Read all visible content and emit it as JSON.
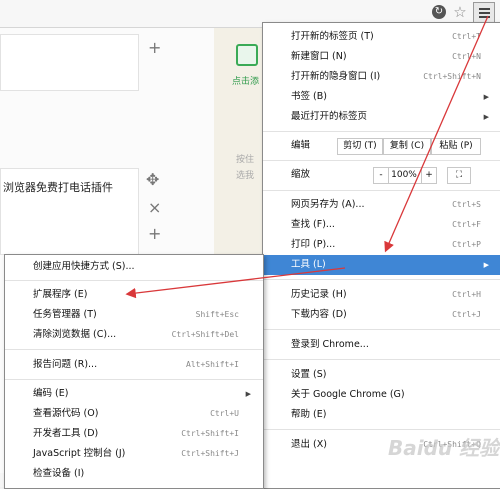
{
  "toolbar": {
    "refresh_glyph": "↻",
    "star_glyph": "☆"
  },
  "background": {
    "plus1": "+",
    "plus2": "+",
    "card2_text": "浏览器免费打电话插件",
    "move_glyph": "✥",
    "close_glyph": "×",
    "green_text": "点击添",
    "gray_text1": "按住",
    "gray_text2": "选我"
  },
  "main_menu": {
    "new_tab": {
      "label": "打开新的标签页 (T)",
      "shortcut": "Ctrl+T"
    },
    "new_window": {
      "label": "新建窗口 (N)",
      "shortcut": "Ctrl+N"
    },
    "incognito": {
      "label": "打开新的隐身窗口 (I)",
      "shortcut": "Ctrl+Shift+N"
    },
    "bookmarks": {
      "label": "书签 (B)"
    },
    "recent_tabs": {
      "label": "最近打开的标签页"
    },
    "edit": {
      "label": "编辑",
      "cut": "剪切 (T)",
      "copy": "复制 (C)",
      "paste": "粘贴 (P)"
    },
    "zoom": {
      "label": "缩放",
      "minus": "-",
      "value": "100%",
      "plus": "+",
      "fullscreen": "⛶"
    },
    "save_as": {
      "label": "网页另存为 (A)...",
      "shortcut": "Ctrl+S"
    },
    "find": {
      "label": "查找 (F)...",
      "shortcut": "Ctrl+F"
    },
    "print": {
      "label": "打印 (P)...",
      "shortcut": "Ctrl+P"
    },
    "tools": {
      "label": "工具 (L)"
    },
    "history": {
      "label": "历史记录 (H)",
      "shortcut": "Ctrl+H"
    },
    "downloads": {
      "label": "下载内容 (D)",
      "shortcut": "Ctrl+J"
    },
    "signin": {
      "label": "登录到 Chrome..."
    },
    "settings": {
      "label": "设置 (S)"
    },
    "about": {
      "label": "关于 Google Chrome (G)"
    },
    "help": {
      "label": "帮助 (E)"
    },
    "exit": {
      "label": "退出 (X)",
      "shortcut": "Ctrl+Shift+Q"
    }
  },
  "tools_menu": {
    "create_shortcut": {
      "label": "创建应用快捷方式 (S)..."
    },
    "extensions": {
      "label": "扩展程序 (E)"
    },
    "task_manager": {
      "label": "任务管理器 (T)",
      "shortcut": "Shift+Esc"
    },
    "clear_data": {
      "label": "清除浏览数据 (C)...",
      "shortcut": "Ctrl+Shift+Del"
    },
    "report_issue": {
      "label": "报告问题 (R)...",
      "shortcut": "Alt+Shift+I"
    },
    "encoding": {
      "label": "编码 (E)"
    },
    "view_source": {
      "label": "查看源代码 (O)",
      "shortcut": "Ctrl+U"
    },
    "dev_tools": {
      "label": "开发者工具 (D)",
      "shortcut": "Ctrl+Shift+I"
    },
    "js_console": {
      "label": "JavaScript 控制台 (J)",
      "shortcut": "Ctrl+Shift+J"
    },
    "inspect_devices": {
      "label": "检查设备 (I)"
    }
  },
  "watermark": "Baidu 经验",
  "colors": {
    "highlight": "#3f86d5",
    "arrow": "#d9383a"
  }
}
